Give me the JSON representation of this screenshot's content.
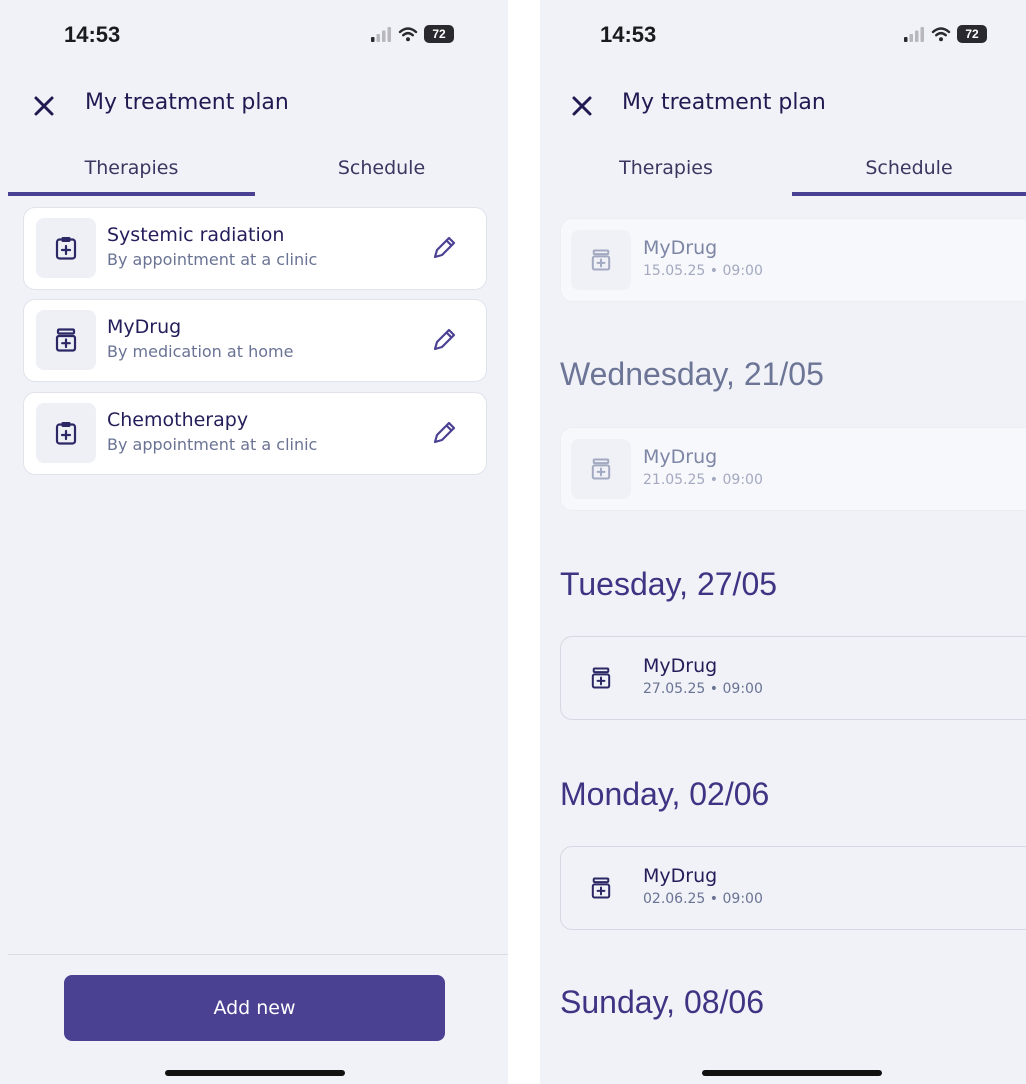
{
  "status_left": {
    "time": "14:53",
    "battery": "72"
  },
  "status_right": {
    "time": "14:53",
    "battery": "72"
  },
  "header": {
    "title": "My treatment plan"
  },
  "tabs": [
    {
      "label": "Therapies"
    },
    {
      "label": "Schedule"
    }
  ],
  "therapies": [
    {
      "title": "Systemic radiation",
      "subtitle": "By appointment at a clinic",
      "icon": "clipboard-plus-icon"
    },
    {
      "title": "MyDrug",
      "subtitle": "By medication at home",
      "icon": "medicine-bottle-icon"
    },
    {
      "title": "Chemotherapy",
      "subtitle": "By appointment at a clinic",
      "icon": "clipboard-plus-icon"
    }
  ],
  "add_button": "Add new",
  "schedule": {
    "top_item": {
      "title": "MyDrug",
      "datetime": "15.05.25 • 09:00"
    },
    "groups": [
      {
        "day": "Wednesday, 21/05",
        "state": "past",
        "item": {
          "title": "MyDrug",
          "datetime": "21.05.25 • 09:00"
        }
      },
      {
        "day": "Tuesday, 27/05",
        "state": "upcoming",
        "item": {
          "title": "MyDrug",
          "datetime": "27.05.25 • 09:00"
        }
      },
      {
        "day": "Monday, 02/06",
        "state": "upcoming",
        "item": {
          "title": "MyDrug",
          "datetime": "02.06.25 • 09:00"
        }
      },
      {
        "day": "Sunday, 08/06",
        "state": "upcoming"
      }
    ]
  },
  "colors": {
    "accent": "#4a4193",
    "background": "#f0f2f7",
    "title_text": "#231d5a",
    "past_text": "#7e86a6"
  }
}
